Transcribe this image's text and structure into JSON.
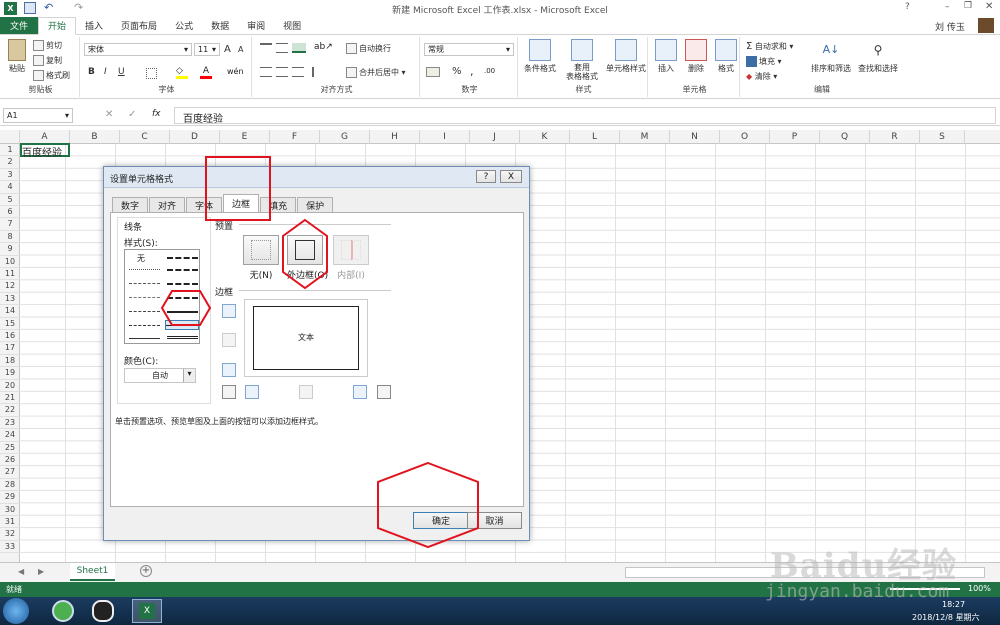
{
  "window": {
    "title": "新建 Microsoft Excel 工作表.xlsx - Microsoft Excel",
    "user": "刘 传玉",
    "help": "?"
  },
  "tabs": [
    "文件",
    "开始",
    "插入",
    "页面布局",
    "公式",
    "数据",
    "审阅",
    "视图"
  ],
  "ribbon": {
    "clipboard": {
      "label": "剪贴板",
      "paste": "粘贴",
      "cut": "剪切",
      "copy": "复制",
      "format_painter": "格式刷"
    },
    "font": {
      "label": "字体",
      "name": "宋体",
      "size": "11",
      "bold": "B",
      "italic": "I",
      "underline": "U",
      "grow": "A",
      "shrink": "A"
    },
    "alignment": {
      "label": "对齐方式",
      "wrap": "自动换行",
      "merge": "合并后居中"
    },
    "number": {
      "label": "数字",
      "format": "常规",
      "percent": "%",
      "comma": ","
    },
    "styles": {
      "label": "样式",
      "conditional": "条件格式",
      "table": "套用\n表格格式",
      "cell": "单元格样式"
    },
    "cells": {
      "label": "单元格",
      "insert": "插入",
      "delete": "删除",
      "format": "格式"
    },
    "editing": {
      "label": "编辑",
      "autosum": "自动求和",
      "fill": "填充",
      "clear": "清除",
      "sort": "排序和筛选",
      "find": "查找和选择"
    }
  },
  "formula_bar": {
    "name_box": "A1",
    "fx": "fx",
    "value": "百度经验"
  },
  "grid": {
    "columns": [
      "A",
      "B",
      "C",
      "D",
      "E",
      "F",
      "G",
      "H",
      "I",
      "J",
      "K",
      "L",
      "M",
      "N",
      "O",
      "P",
      "Q",
      "R",
      "S"
    ],
    "rows": [
      "1",
      "2",
      "3",
      "4",
      "5",
      "6",
      "7",
      "8",
      "9",
      "10",
      "11",
      "12",
      "13",
      "14",
      "15",
      "16",
      "17",
      "18",
      "19",
      "20",
      "21",
      "22",
      "23",
      "24",
      "25",
      "26",
      "27",
      "28",
      "29",
      "30",
      "31",
      "32",
      "33"
    ],
    "a1_value": "百度经验"
  },
  "sheet_tabs": {
    "sheet1": "Sheet1",
    "add": "+"
  },
  "status": {
    "text": "就绪",
    "zoom": "100%"
  },
  "taskbar": {
    "time": "18:27",
    "date": "2018/12/8 星期六"
  },
  "dialog": {
    "title": "设置单元格格式",
    "help": "?",
    "close": "X",
    "tabs": [
      "数字",
      "对齐",
      "字体",
      "边框",
      "填充",
      "保护"
    ],
    "active_tab": "边框",
    "line_group": "线条",
    "style_label": "样式(S):",
    "style_none": "无",
    "color_label": "颜色(C):",
    "color_value": "自动",
    "presets_label": "预置",
    "presets": [
      "无(N)",
      "外边框(O)",
      "内部(I)"
    ],
    "border_label": "边框",
    "preview_text": "文本",
    "hint": "单击预置选项、预览草图及上面的按钮可以添加边框样式。",
    "ok": "确定",
    "cancel": "取消"
  },
  "watermark": {
    "brand": "Baidu经验",
    "url": "jingyan.baidu.com"
  },
  "colors": {
    "excel_green": "#217346",
    "annotation_red": "#e0141e"
  }
}
